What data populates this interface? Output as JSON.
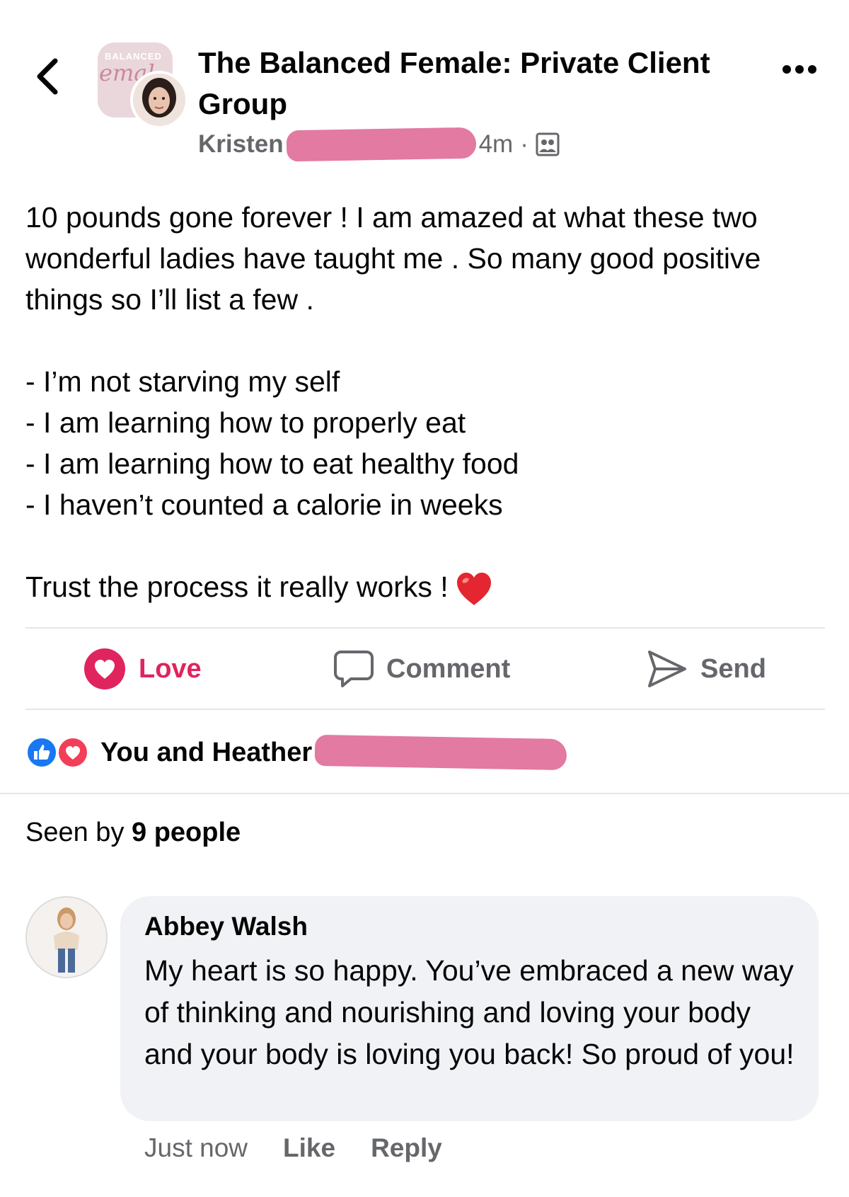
{
  "header": {
    "back_icon": "chevron-left-icon",
    "group_name": "The Balanced Female: Private Client Group",
    "group_logo_top": "BALANCED",
    "group_logo_script": "emal",
    "author_first_name": "Kristen",
    "time_ago": "4m",
    "privacy_icon": "group-members-icon",
    "more_icon": "more-options-icon"
  },
  "post": {
    "paragraph_1": "10 pounds gone forever ! I am amazed at what these two wonderful ladies have taught me . So many good positive things so I’ll list a few .",
    "list": [
      "- I’m not starving my self",
      "- I am learning how to properly eat",
      "- I am learning how to eat healthy food",
      "- I haven’t counted a calorie in weeks"
    ],
    "closing": "Trust the process it really works !",
    "closing_emoji": "heart-emoji"
  },
  "actions": {
    "love_label": "Love",
    "comment_label": "Comment",
    "send_label": "Send",
    "colors": {
      "love": "#e0245e",
      "muted": "#65676b"
    }
  },
  "reactions": {
    "summary": "You and Heather",
    "icons": [
      "like-icon",
      "love-icon"
    ]
  },
  "seen_by": {
    "prefix": "Seen by",
    "count_label": "9 people"
  },
  "comment": {
    "author": "Abbey Walsh",
    "text": "My heart is so happy. You’ve embraced a new way of thinking and nourishing and loving your body and your body is loving you back! So proud of you!",
    "time": "Just now",
    "like_label": "Like",
    "reply_label": "Reply"
  }
}
